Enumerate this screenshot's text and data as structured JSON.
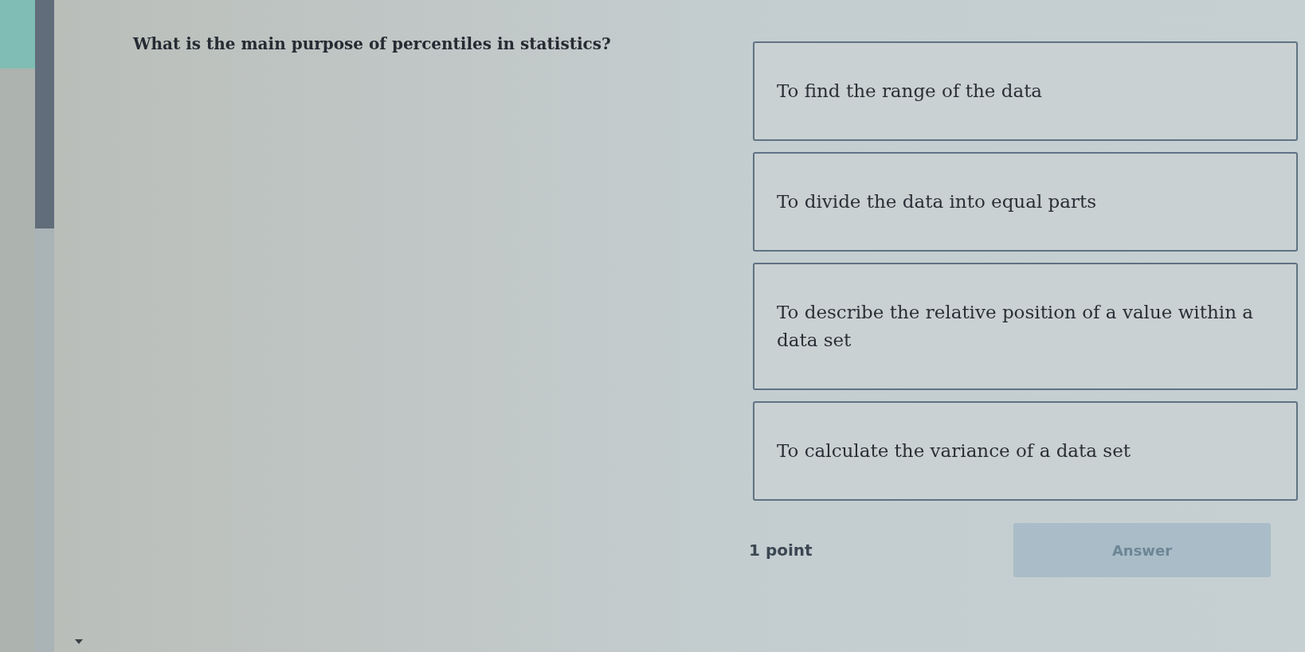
{
  "progress": {
    "level": 0.35
  },
  "question": {
    "text": "What is the main purpose of percentiles in statistics?"
  },
  "options": [
    {
      "text": "To find the range of the data",
      "selected": false
    },
    {
      "text": "To divide the data into equal parts",
      "selected": false
    },
    {
      "text": "To describe the relative position of a value within a data set",
      "selected": false
    },
    {
      "text": "To calculate the variance of a data set",
      "selected": false
    }
  ],
  "footer": {
    "points": "1 point",
    "answer_button": {
      "label": "Answer",
      "disabled": true
    }
  }
}
